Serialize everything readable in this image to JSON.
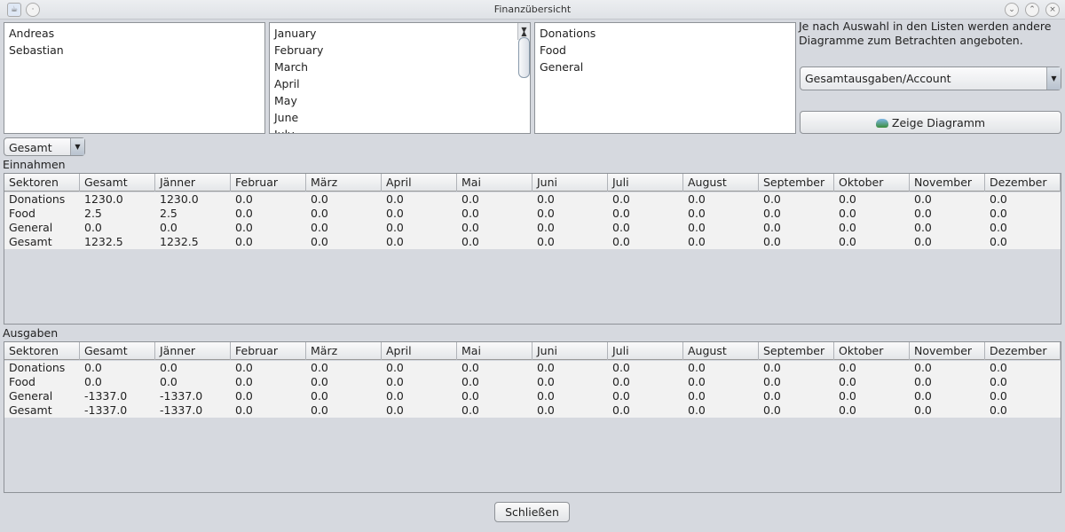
{
  "window": {
    "title": "Finanzübersicht"
  },
  "persons": [
    "Andreas",
    "Sebastian"
  ],
  "months": [
    "January",
    "February",
    "March",
    "April",
    "May",
    "June",
    "July"
  ],
  "sectors": [
    "Donations",
    "Food",
    "General"
  ],
  "info_text": "Je nach Auswahl in den Listen werden andere Diagramme zum Betrachten angeboten.",
  "chart_select": {
    "value": "Gesamtausgaben/Account"
  },
  "show_chart_button": "Zeige Diagramm",
  "filter_select": {
    "value": "Gesamt"
  },
  "columns": [
    "Sektoren",
    "Gesamt",
    "Jänner",
    "Februar",
    "März",
    "April",
    "Mai",
    "Juni",
    "Juli",
    "August",
    "September",
    "Oktober",
    "November",
    "Dezember"
  ],
  "income": {
    "label": "Einnahmen",
    "rows": [
      [
        "Donations",
        "1230.0",
        "1230.0",
        "0.0",
        "0.0",
        "0.0",
        "0.0",
        "0.0",
        "0.0",
        "0.0",
        "0.0",
        "0.0",
        "0.0",
        "0.0"
      ],
      [
        "Food",
        "2.5",
        "2.5",
        "0.0",
        "0.0",
        "0.0",
        "0.0",
        "0.0",
        "0.0",
        "0.0",
        "0.0",
        "0.0",
        "0.0",
        "0.0"
      ],
      [
        "General",
        "0.0",
        "0.0",
        "0.0",
        "0.0",
        "0.0",
        "0.0",
        "0.0",
        "0.0",
        "0.0",
        "0.0",
        "0.0",
        "0.0",
        "0.0"
      ],
      [
        "Gesamt",
        "1232.5",
        "1232.5",
        "0.0",
        "0.0",
        "0.0",
        "0.0",
        "0.0",
        "0.0",
        "0.0",
        "0.0",
        "0.0",
        "0.0",
        "0.0"
      ]
    ]
  },
  "expenses": {
    "label": "Ausgaben",
    "rows": [
      [
        "Donations",
        "0.0",
        "0.0",
        "0.0",
        "0.0",
        "0.0",
        "0.0",
        "0.0",
        "0.0",
        "0.0",
        "0.0",
        "0.0",
        "0.0",
        "0.0"
      ],
      [
        "Food",
        "0.0",
        "0.0",
        "0.0",
        "0.0",
        "0.0",
        "0.0",
        "0.0",
        "0.0",
        "0.0",
        "0.0",
        "0.0",
        "0.0",
        "0.0"
      ],
      [
        "General",
        "-1337.0",
        "-1337.0",
        "0.0",
        "0.0",
        "0.0",
        "0.0",
        "0.0",
        "0.0",
        "0.0",
        "0.0",
        "0.0",
        "0.0",
        "0.0"
      ],
      [
        "Gesamt",
        "-1337.0",
        "-1337.0",
        "0.0",
        "0.0",
        "0.0",
        "0.0",
        "0.0",
        "0.0",
        "0.0",
        "0.0",
        "0.0",
        "0.0",
        "0.0"
      ]
    ]
  },
  "close_button": "Schließen"
}
